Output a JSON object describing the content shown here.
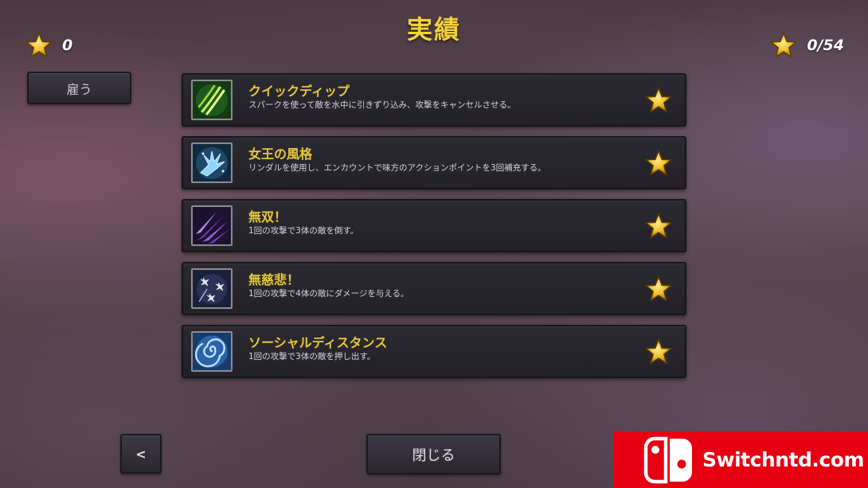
{
  "header": {
    "title": "実績"
  },
  "stars_earned": "0",
  "achievement_progress": "0/54",
  "hire_button": "雇う",
  "achievements": [
    {
      "title": "クイックディップ",
      "description": "スパークを使って敵を水中に引きずり込み、攻撃をキャンセルさせる。",
      "icon": "claw-slash-icon"
    },
    {
      "title": "女王の風格",
      "description": "リンダルを使用し、エンカウントで味方のアクションポイントを3回補充する。",
      "icon": "ice-hand-icon"
    },
    {
      "title": "無双！",
      "description": "1回の攻撃で3体の敵を倒す。",
      "icon": "purple-shards-icon"
    },
    {
      "title": "無慈悲！",
      "description": "1回の攻撃で4体の敵にダメージを与える。",
      "icon": "shuriken-icon"
    },
    {
      "title": "ソーシャルディスタンス",
      "description": "1回の攻撃で3体の敵を押し出す。",
      "icon": "vortex-icon"
    }
  ],
  "footer": {
    "back_label": "<",
    "close_label": "閉じる"
  },
  "watermark": {
    "text": "Switchntd.com"
  },
  "colors": {
    "title_gold": "#f4d23c",
    "achievement_title": "#e8c93a",
    "star_gold": "#e9b422",
    "watermark_red": "#e60012"
  }
}
